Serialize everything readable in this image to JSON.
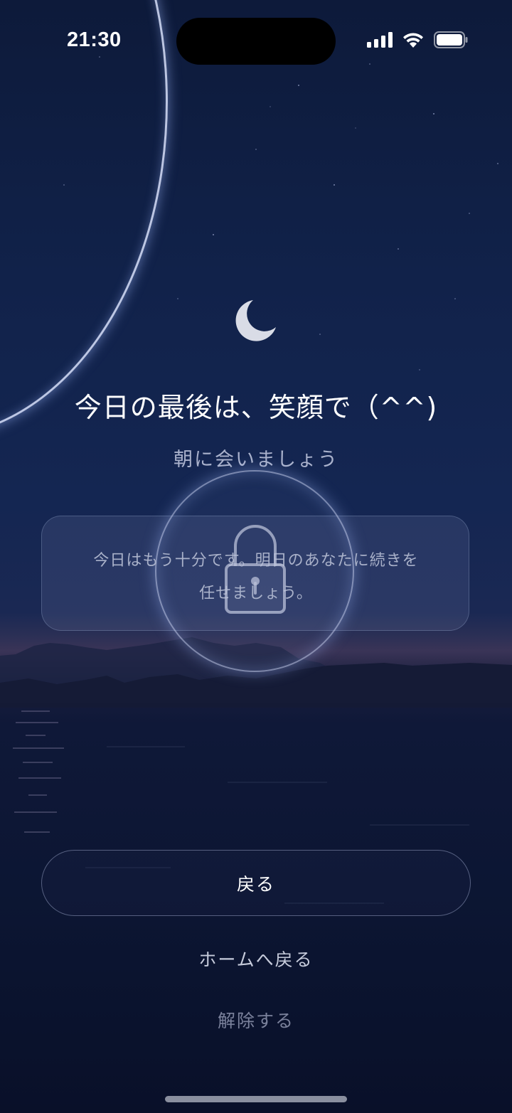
{
  "status_bar": {
    "time": "21:30",
    "icons": [
      "cellular-signal-icon",
      "wifi-icon",
      "battery-icon"
    ]
  },
  "moon_icon": "crescent-moon-icon",
  "title": "今日の最後は、笑顔で（^^)",
  "subtitle": "朝に会いましょう",
  "message": {
    "line1": "今日はもう十分です。明日のあなたに続きを",
    "line2": "任せましょう。"
  },
  "lock_icon": "padlock-icon",
  "buttons": {
    "back_label": "戻る",
    "home_label": "ホームへ戻る",
    "unlock_label": "解除する"
  },
  "colors": {
    "sky_top": "#0d1a3a",
    "horizon_glow": "#3a3457",
    "water": "#091029",
    "ring_glow": "#a0b9ff",
    "text_primary": "#ffffff",
    "text_secondary": "#aab2cc",
    "text_muted": "#7b829c"
  }
}
